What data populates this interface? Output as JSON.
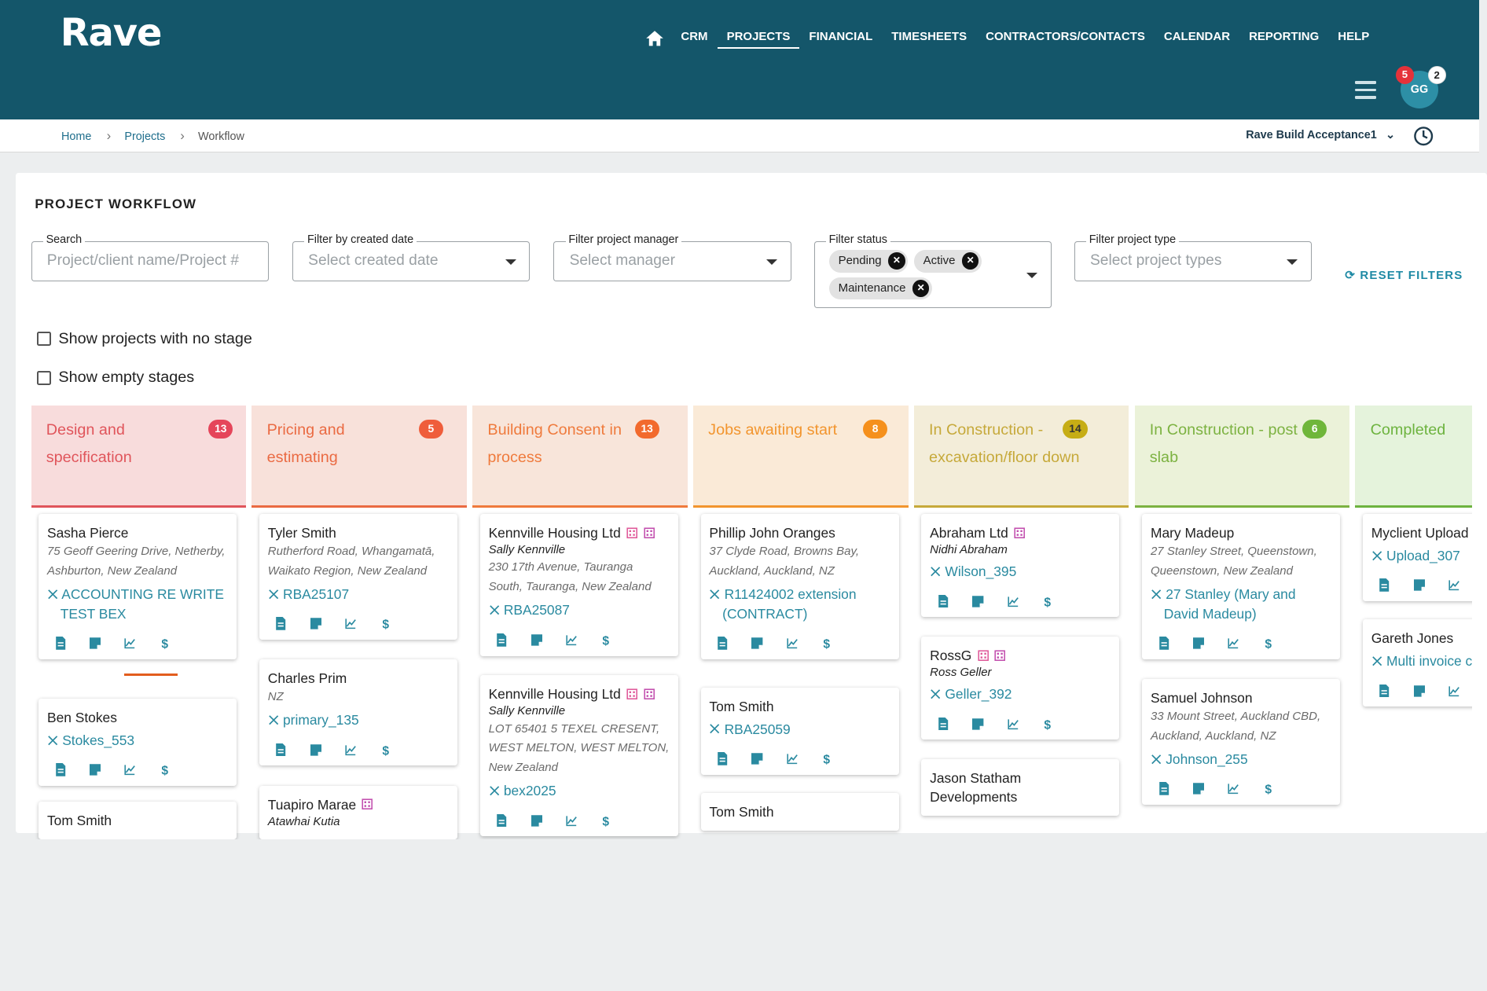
{
  "app": {
    "logo": "Rave"
  },
  "nav": {
    "items": [
      "CRM",
      "PROJECTS",
      "FINANCIAL",
      "TIMESHEETS",
      "CONTRACTORS/CONTACTS",
      "CALENDAR",
      "REPORTING",
      "HELP"
    ],
    "active": "PROJECTS"
  },
  "user": {
    "initials": "GG",
    "badge_red": "5",
    "badge_white": "2"
  },
  "breadcrumb": {
    "home": "Home",
    "projects": "Projects",
    "current": "Workflow"
  },
  "org": {
    "name": "Rave Build Acceptance1"
  },
  "page": {
    "title": "PROJECT WORKFLOW"
  },
  "filters": {
    "search": {
      "label": "Search",
      "placeholder": "Project/client name/Project #"
    },
    "created": {
      "label": "Filter by created date",
      "placeholder": "Select created date"
    },
    "manager": {
      "label": "Filter project manager",
      "placeholder": "Select manager"
    },
    "status": {
      "label": "Filter status",
      "chips": [
        "Pending",
        "Active",
        "Maintenance"
      ]
    },
    "type": {
      "label": "Filter project type",
      "placeholder": "Select project types"
    },
    "reset": "RESET FILTERS"
  },
  "toggles": {
    "no_stage": "Show projects with no stage",
    "empty_stages": "Show empty stages"
  },
  "colors": {
    "header": "#14566a",
    "link": "#2a8aa0",
    "accent_underline": "#e25d1e"
  },
  "columns": [
    {
      "title": "Design and specification",
      "count": "13",
      "bg": "#f8dcdc",
      "fg": "#e0555b",
      "badge": "#e5455a",
      "cards": [
        {
          "name": "Sasha Pierce",
          "address": "75 Geoff Geering Drive, Netherby, Ashburton, New Zealand",
          "project": "ACCOUNTING RE WRITE TEST BEX"
        },
        {
          "name": "Ben Stokes",
          "project": "Stokes_553"
        },
        {
          "name": "Tom Smith"
        }
      ]
    },
    {
      "title": "Pricing and estimating",
      "count": "5",
      "bg": "#f8e1da",
      "fg": "#ea6a42",
      "badge": "#ef5d3b",
      "cards": [
        {
          "name": "Tyler Smith",
          "address": "Rutherford Road, Whangamatā, Waikato Region, New Zealand",
          "project": "RBA25107"
        },
        {
          "name": "Charles Prim",
          "address": "NZ",
          "project": "primary_135"
        },
        {
          "name": "Tuapiro Marae",
          "contact": "Atawhai Kutia"
        }
      ]
    },
    {
      "title": "Building Consent in process",
      "count": "13",
      "bg": "#f8e5da",
      "fg": "#ef7a3c",
      "badge": "#f26a2d",
      "cards": [
        {
          "name": "Kennville Housing Ltd",
          "contact": "Sally Kennville",
          "address": "230 17th Avenue, Tauranga South, Tauranga, New Zealand",
          "project": "RBA25087"
        },
        {
          "name": "Kennville Housing Ltd",
          "contact": "Sally Kennville",
          "address": "LOT 65401 5 TEXEL CRESENT, WEST MELTON, WEST MELTON, New Zealand",
          "project": "bex2025"
        }
      ]
    },
    {
      "title": "Jobs awaiting start",
      "count": "8",
      "bg": "#faead7",
      "fg": "#f2952e",
      "badge": "#f5901c",
      "cards": [
        {
          "name": "Phillip John Oranges",
          "address": "37 Clyde Road, Browns Bay, Auckland, Auckland, NZ",
          "project": "R11424002 extension (CONTRACT)"
        },
        {
          "name": "Tom Smith",
          "project": "RBA25059"
        },
        {
          "name": "Tom Smith"
        }
      ]
    },
    {
      "title": "In Construction - excavation/floor down",
      "count": "14",
      "bg": "#f3edd9",
      "fg": "#c6a93a",
      "badge": "#c6ad15",
      "cards": [
        {
          "name": "Abraham Ltd",
          "contact": "Nidhi Abraham",
          "project": "Wilson_395"
        },
        {
          "name": "RossG",
          "contact": "Ross Geller",
          "project": "Geller_392"
        },
        {
          "name": "Jason Statham Developments"
        }
      ]
    },
    {
      "title": "In Construction - post slab",
      "count": "6",
      "bg": "#ebf2d9",
      "fg": "#7cb241",
      "badge": "#6fb63a",
      "cards": [
        {
          "name": "Mary Madeup",
          "address": "27 Stanley Street, Queenstown, Queenstown, New Zealand",
          "project": "27 Stanley (Mary and David Madeup)"
        },
        {
          "name": "Samuel Johnson",
          "address": "33 Mount Street, Auckland CBD, Auckland, Auckland, NZ",
          "project": "Johnson_255"
        }
      ]
    },
    {
      "title": "Completed",
      "count": "",
      "bg": "#e5f3dc",
      "fg": "#6db33f",
      "badge": "#6db33f",
      "cards": [
        {
          "name": "Myclient Upload",
          "project": "Upload_307"
        },
        {
          "name": "Gareth Jones",
          "project": "Multi invoice contract test"
        }
      ]
    }
  ]
}
